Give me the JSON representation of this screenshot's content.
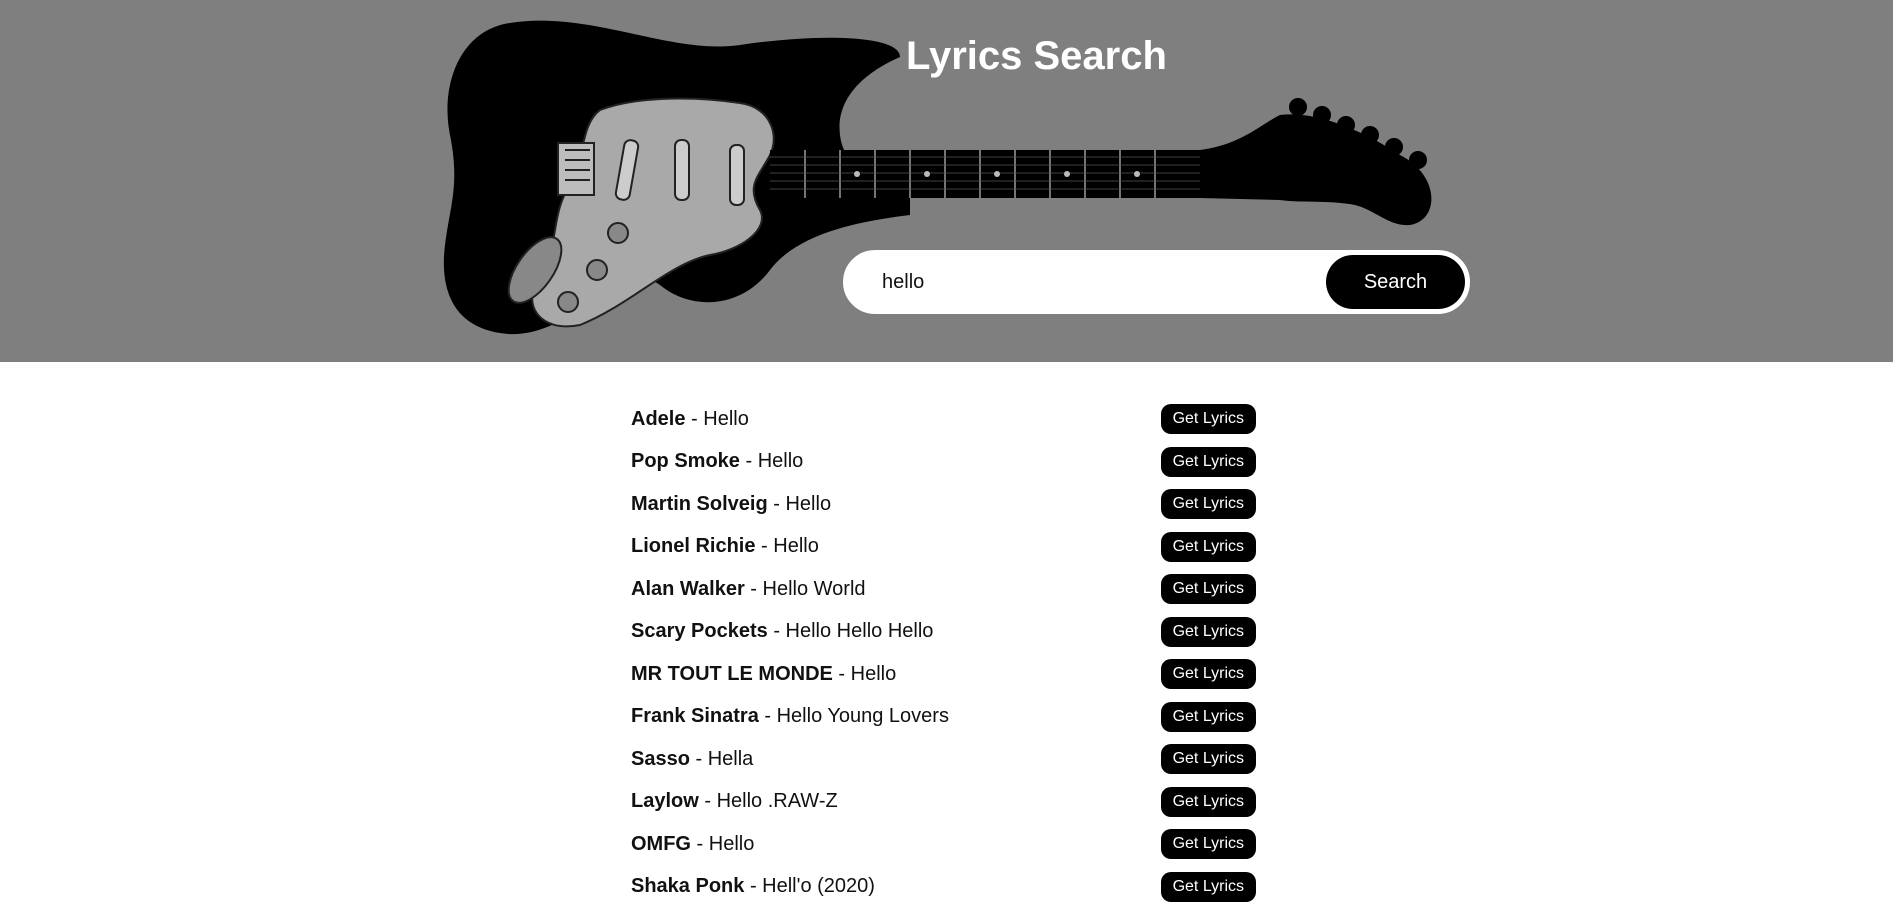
{
  "header": {
    "title": "Lyrics Search"
  },
  "search": {
    "value": "hello",
    "button_label": "Search"
  },
  "results": [
    {
      "artist": "Adele",
      "separator": " - ",
      "title": "Hello",
      "button_label": "Get Lyrics"
    },
    {
      "artist": "Pop Smoke",
      "separator": " - ",
      "title": "Hello",
      "button_label": "Get Lyrics"
    },
    {
      "artist": "Martin Solveig",
      "separator": " - ",
      "title": "Hello",
      "button_label": "Get Lyrics"
    },
    {
      "artist": "Lionel Richie",
      "separator": " - ",
      "title": "Hello",
      "button_label": "Get Lyrics"
    },
    {
      "artist": "Alan Walker",
      "separator": " - ",
      "title": "Hello World",
      "button_label": "Get Lyrics"
    },
    {
      "artist": "Scary Pockets",
      "separator": " - ",
      "title": "Hello Hello Hello",
      "button_label": "Get Lyrics"
    },
    {
      "artist": "MR TOUT LE MONDE",
      "separator": " - ",
      "title": "Hello",
      "button_label": "Get Lyrics"
    },
    {
      "artist": "Frank Sinatra",
      "separator": " - ",
      "title": "Hello Young Lovers",
      "button_label": "Get Lyrics"
    },
    {
      "artist": "Sasso",
      "separator": " - ",
      "title": "Hella",
      "button_label": "Get Lyrics"
    },
    {
      "artist": "Laylow",
      "separator": " - ",
      "title": "Hello .RAW-Z",
      "button_label": "Get Lyrics"
    },
    {
      "artist": "OMFG",
      "separator": " - ",
      "title": "Hello",
      "button_label": "Get Lyrics"
    },
    {
      "artist": "Shaka Ponk",
      "separator": " - ",
      "title": "Hell'o (2020)",
      "button_label": "Get Lyrics"
    }
  ]
}
